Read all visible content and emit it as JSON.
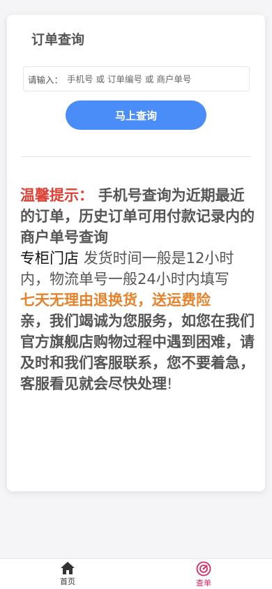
{
  "page": {
    "title": "订单查询"
  },
  "search": {
    "label": "请输入：",
    "placeholder": "手机号 或 订单编号 或 商户单号",
    "value": ""
  },
  "actions": {
    "query_button": "马上查询"
  },
  "notice": {
    "tip_label": "温馨提示：",
    "tip_text": "手机号查询为近期最近的订单，历史订单可用付款记录内的商户单号查询",
    "store_label": "专柜门店",
    "store_text": "发货时间一般是12小时内，物流单号一般24小时内填写",
    "return_label": "七天无理由退换货，送运费险",
    "service_text": "亲，我们竭诚为您服务，如您在我们官方旗舰店购物过程中遇到困难，请及时和我们客服联系，您不要着急，客服看见就会尽快处理",
    "service_end": "!"
  },
  "tabbar": {
    "items": [
      {
        "label": "首页",
        "icon": "home-icon",
        "active": false
      },
      {
        "label": "查单",
        "icon": "query-icon",
        "active": true
      }
    ],
    "active_color": "#e0245e"
  },
  "colors": {
    "accent": "#4a8df8",
    "tip_red": "#e04034",
    "highlight_orange": "#e8822a"
  }
}
